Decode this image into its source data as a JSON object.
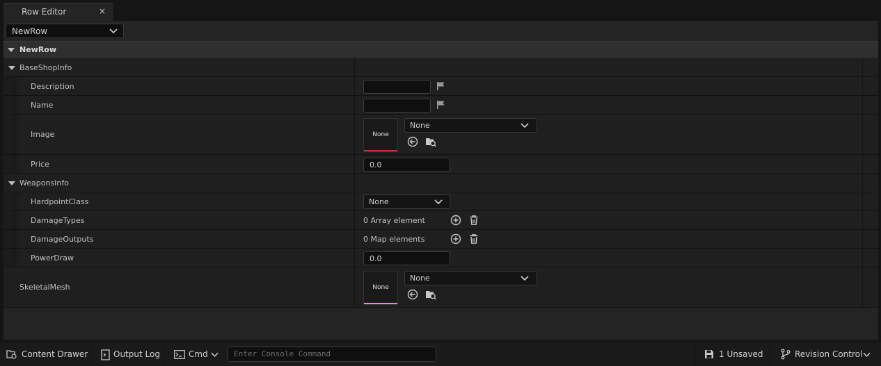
{
  "tab": {
    "title": "Row Editor",
    "close": "×"
  },
  "row_selector": {
    "value": "NewRow"
  },
  "category": {
    "title": "NewRow"
  },
  "groups": {
    "base_shop": {
      "label": "BaseShopInfo",
      "description": {
        "label": "Description",
        "value": ""
      },
      "name": {
        "label": "Name",
        "value": ""
      },
      "image": {
        "label": "Image",
        "thumb": "None",
        "asset": "None"
      },
      "price": {
        "label": "Price",
        "value": "0.0"
      }
    },
    "weapons": {
      "label": "WeaponsInfo",
      "hardpoint": {
        "label": "HardpointClass",
        "value": "None"
      },
      "damage_types": {
        "label": "DamageTypes",
        "value": "0 Array element"
      },
      "damage_outputs": {
        "label": "DamageOutputs",
        "value": "0 Map elements"
      },
      "power_draw": {
        "label": "PowerDraw",
        "value": "0.0"
      }
    }
  },
  "skeletal_mesh": {
    "label": "SkeletalMesh",
    "thumb": "None",
    "asset": "None"
  },
  "statusbar": {
    "content_drawer": "Content Drawer",
    "output_log": "Output Log",
    "cmd": "Cmd",
    "console_placeholder": "Enter Console Command",
    "unsaved": "1 Unsaved",
    "revision_control": "Revision Control"
  },
  "colors": {
    "image_thumb_accent": "#b8353a",
    "mesh_thumb_accent": "#e08ad8"
  },
  "icons": [
    "close-icon",
    "chevron-down-icon",
    "flag-icon",
    "use-selected-icon",
    "browse-icon",
    "add-icon",
    "trash-icon",
    "content-drawer-icon",
    "output-log-icon",
    "terminal-icon",
    "save-icon",
    "branch-icon"
  ]
}
